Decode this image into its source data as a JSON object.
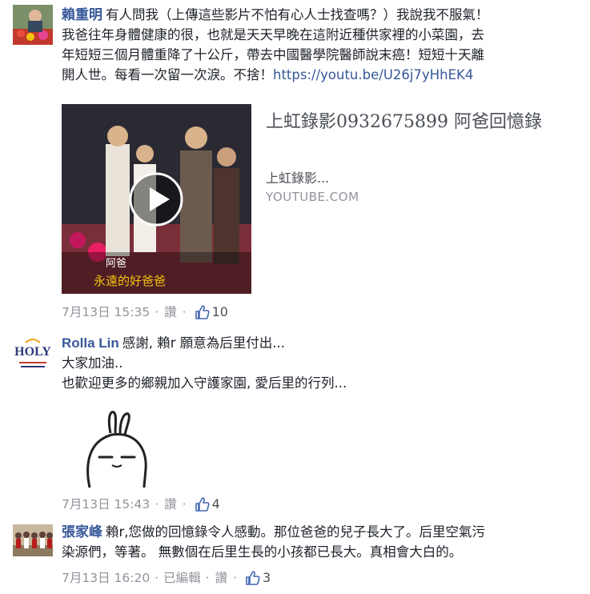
{
  "comments": [
    {
      "author": "賴重明",
      "text_l1": "有人問我（上傳這些影片不怕有心人士找查嗎？）我說我不服氣！",
      "text_l2": "我爸往年身體健康的很，也就是天天早晚在這附近種供家裡的小菜園，去",
      "text_l3": "年短短三個月體重降了十公斤，帶去中國醫學院醫師說末癌！短短十天離",
      "text_l4": "開人世。每看一次留一次淚。不捨！",
      "link": "https://youtu.be/U26j7yHhEK4",
      "card": {
        "title": "上虹錄影0932675899 阿爸回憶錄",
        "description": "上虹錄影...",
        "domain": "YOUTUBE.COM",
        "caption1": "阿爸",
        "caption2": "永遠的好爸爸"
      },
      "timestamp": "7月13日 15:35",
      "like_label": "讚",
      "likes": "10"
    },
    {
      "author": "Rolla Lin",
      "avatar_text": "HOLY",
      "text_l1": "感謝, 賴r 願意為后里付出...",
      "text_l2": "大家加油..",
      "text_l3": "也歡迎更多的鄉親加入守護家園, 愛后里的行列...",
      "timestamp": "7月13日 15:43",
      "like_label": "讚",
      "likes": "4"
    },
    {
      "author": "張家峰",
      "text_l1": "賴r,您做的回憶錄令人感動。那位爸爸的兒子長大了。后里空氣污",
      "text_l2": "染源們，等著。 無數個在后里生長的小孩都已長大。真相會大白的。",
      "timestamp": "7月13日 16:20",
      "edited_label": "已編輯",
      "like_label": "讚",
      "likes": "3"
    }
  ],
  "colors": {
    "link": "#365899",
    "meta": "#90949c",
    "like": "#4267b2"
  },
  "icons": [
    "thumbs-up-icon",
    "play-icon"
  ]
}
